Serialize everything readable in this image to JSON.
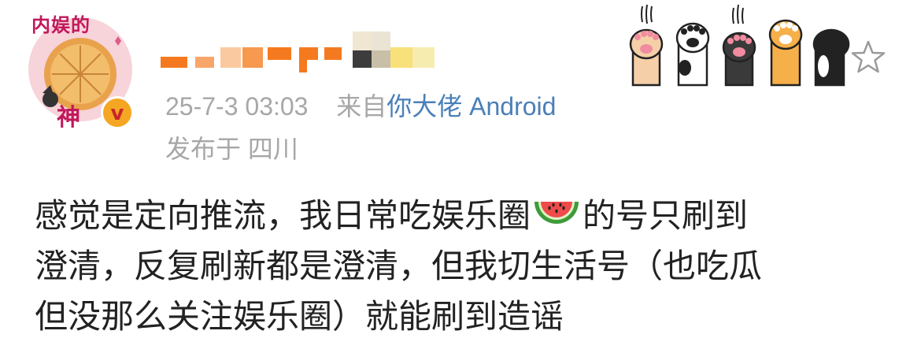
{
  "avatar": {
    "title_text": "内娱的",
    "bottom_text": "神",
    "badge_text": "v"
  },
  "post": {
    "timestamp": "25-7-3 03:03",
    "source_prefix": "来自",
    "source_app": "你大佬 Android",
    "location": "发布于 四川"
  },
  "content": {
    "line1_before": "感觉是定向推流，我日常吃娱乐圈",
    "line1_after": "的号只刷到",
    "line2": "澄清，反复刷新都是澄清，但我切生活号（也吃瓜",
    "line3": "但没那么关注娱乐圈）就能刷到造谣",
    "emoji_icon": "watermelon-icon"
  },
  "colors": {
    "meta_gray": "#a7a7a7",
    "source_blue": "#4a7fb8",
    "text": "#222222",
    "badge": "#f5a623"
  }
}
